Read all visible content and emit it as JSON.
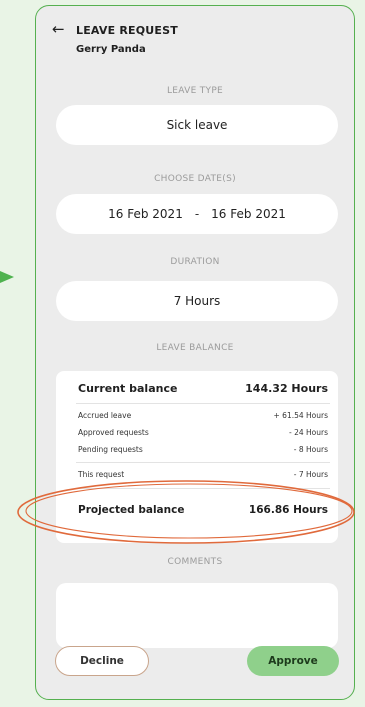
{
  "header": {
    "back_icon": "arrow-left-icon",
    "title": "LEAVE REQUEST",
    "name": "Gerry Panda"
  },
  "leave_type": {
    "label": "LEAVE TYPE",
    "value": "Sick leave"
  },
  "dates": {
    "label": "CHOOSE DATE(S)",
    "start": "16 Feb 2021",
    "separator": "-",
    "end": "16 Feb 2021"
  },
  "duration": {
    "label": "DURATION",
    "value": "7 Hours"
  },
  "balance": {
    "label": "LEAVE BALANCE",
    "current_label": "Current balance",
    "current_value": "144.32 Hours",
    "rows": [
      {
        "label": "Accrued leave",
        "value": "+ 61.54 Hours"
      },
      {
        "label": "Approved requests",
        "value": "- 24 Hours"
      },
      {
        "label": "Pending requests",
        "value": "- 8 Hours"
      }
    ],
    "this_request_label": "This request",
    "this_request_value": "- 7 Hours",
    "projected_label": "Projected balance",
    "projected_value": "166.86 Hours"
  },
  "comments": {
    "label": "COMMENTS",
    "value": ""
  },
  "actions": {
    "decline": "Decline",
    "approve": "Approve"
  },
  "colors": {
    "accent_green": "#4fb24f",
    "approve_bg": "#8fd08b",
    "highlight_ellipse": "#e06a3c"
  }
}
